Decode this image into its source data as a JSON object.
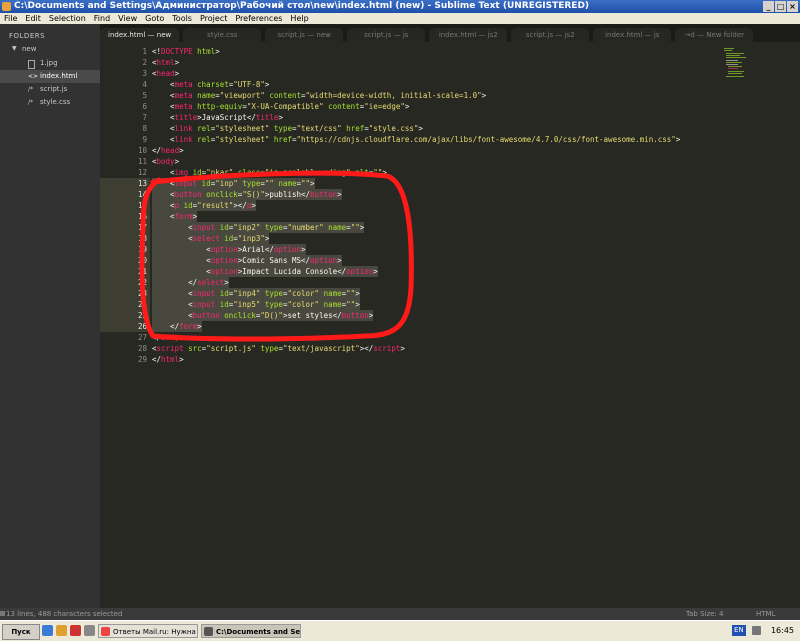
{
  "window": {
    "title": "C:\\Documents and Settings\\Администратор\\Рабочий стол\\new\\index.html (new) - Sublime Text (UNREGISTERED)",
    "controls": [
      "_",
      "□",
      "×"
    ]
  },
  "menu": [
    "File",
    "Edit",
    "Selection",
    "Find",
    "View",
    "Goto",
    "Tools",
    "Project",
    "Preferences",
    "Help"
  ],
  "sidebar": {
    "header": "FOLDERS",
    "folder": "new",
    "files": [
      {
        "name": "1.jpg",
        "active": false
      },
      {
        "name": "index.html",
        "active": true
      },
      {
        "name": "script.js",
        "active": false
      },
      {
        "name": "style.css",
        "active": false
      }
    ]
  },
  "tabs": [
    {
      "label": "index.html — new",
      "active": true
    },
    {
      "label": "style.css",
      "active": false
    },
    {
      "label": "script.js — new",
      "active": false
    },
    {
      "label": "script.js — js",
      "active": false
    },
    {
      "label": "index.html — js2",
      "active": false
    },
    {
      "label": "script.js — js2",
      "active": false
    },
    {
      "label": "index.html — js",
      "active": false
    },
    {
      "label": "→d — New folder",
      "active": false
    }
  ],
  "code_lines": [
    {
      "n": "1",
      "html": "<span class=\"p\">&lt;!</span><span class=\"t\">DOCTYPE</span> <span class=\"a\">html</span><span class=\"p\">&gt;</span>"
    },
    {
      "n": "2",
      "html": "&lt;<span class=\"t\">html</span>&gt;"
    },
    {
      "n": "3",
      "html": "&lt;<span class=\"t\">head</span>&gt;"
    },
    {
      "n": "4",
      "html": "    &lt;<span class=\"t\">meta</span> <span class=\"a\">charset</span>=<span class=\"s\">\"UTF-8\"</span>&gt;"
    },
    {
      "n": "5",
      "html": "    &lt;<span class=\"t\">meta</span> <span class=\"a\">name</span>=<span class=\"s\">\"viewport\"</span> <span class=\"a\">content</span>=<span class=\"s\">\"width=device-width, initial-scale=1.0\"</span>&gt;"
    },
    {
      "n": "6",
      "html": "    &lt;<span class=\"t\">meta</span> <span class=\"a\">http-equiv</span>=<span class=\"s\">\"X-UA-Compatible\"</span> <span class=\"a\">content</span>=<span class=\"s\">\"ie=edge\"</span>&gt;"
    },
    {
      "n": "7",
      "html": "    &lt;<span class=\"t\">title</span>&gt;JavaScript&lt;/<span class=\"t\">title</span>&gt;"
    },
    {
      "n": "8",
      "html": "    &lt;<span class=\"t\">link</span> <span class=\"a\">rel</span>=<span class=\"s\">\"stylesheet\"</span> <span class=\"a\">type</span>=<span class=\"s\">\"text/css\"</span> <span class=\"a\">href</span>=<span class=\"s\">\"style.css\"</span>&gt;"
    },
    {
      "n": "9",
      "html": "    &lt;<span class=\"t\">link</span> <span class=\"a\">rel</span>=<span class=\"s\">\"stylesheet\"</span> <span class=\"a\">href</span>=<span class=\"s\">\"https://cdnjs.cloudflare.com/ajax/libs/font-awesome/4.7.0/css/font-awesome.min.css\"</span>&gt;"
    },
    {
      "n": "10",
      "html": "&lt;/<span class=\"t\">head</span>&gt;"
    },
    {
      "n": "11",
      "html": "&lt;<span class=\"t\">body</span>&gt;"
    },
    {
      "n": "12",
      "html": "    &lt;<span class=\"t\">img</span> <span class=\"a\">id</span>=<span class=\"s\">\"nkar\"</span> <span class=\"a\">class</span>=<span class=\"s\">\"is-scalabl  ading\"</span> <span class=\"a\">alt</span>=<span class=\"s\">\"\"</span>&gt;"
    },
    {
      "n": "13",
      "sel": true,
      "html": "    &lt;<span class=\"t\">input</span> <span class=\"a\">id</span>=<span class=\"s\">\"inp\"</span> <span class=\"a\">type</span>=<span class=\"s\">\"\"</span> <span class=\"a\">name</span>=<span class=\"s\">\"\"</span>&gt;"
    },
    {
      "n": "14",
      "sel": true,
      "html": "    &lt;<span class=\"t\">button</span> <span class=\"a\">onclick</span>=<span class=\"s\">\"S()\"</span>&gt;publish&lt;/<span class=\"t\">button</span>&gt;"
    },
    {
      "n": "15",
      "sel": true,
      "html": "    &lt;<span class=\"t\">p</span> <span class=\"a\">id</span>=<span class=\"s\">\"result\"</span>&gt;&lt;/<span class=\"t\">p</span>&gt;"
    },
    {
      "n": "16",
      "sel": true,
      "html": "    &lt;<span class=\"t\">form</span>&gt;"
    },
    {
      "n": "17",
      "sel": true,
      "html": "        &lt;<span class=\"t\">input</span> <span class=\"a\">id</span>=<span class=\"s\">\"inp2\"</span> <span class=\"a\">type</span>=<span class=\"s\">\"number\"</span> <span class=\"a\">name</span>=<span class=\"s\">\"\"</span>&gt;"
    },
    {
      "n": "18",
      "sel": true,
      "html": "        &lt;<span class=\"t\">select</span> <span class=\"a\">id</span>=<span class=\"s\">\"inp3\"</span>&gt;"
    },
    {
      "n": "19",
      "sel": true,
      "html": "            &lt;<span class=\"t\">option</span>&gt;Arial&lt;/<span class=\"t\">option</span>&gt;"
    },
    {
      "n": "20",
      "sel": true,
      "html": "            &lt;<span class=\"t\">option</span>&gt;Comic Sans MS&lt;/<span class=\"t\">option</span>&gt;"
    },
    {
      "n": "21",
      "sel": true,
      "html": "            &lt;<span class=\"t\">option</span>&gt;Impact Lucida Console&lt;/<span class=\"t\">option</span>&gt;"
    },
    {
      "n": "22",
      "sel": true,
      "html": "        &lt;/<span class=\"t\">select</span>&gt;"
    },
    {
      "n": "23",
      "sel": true,
      "html": "        &lt;<span class=\"t\">input</span> <span class=\"a\">id</span>=<span class=\"s\">\"inp4\"</span> <span class=\"a\">type</span>=<span class=\"s\">\"color\"</span> <span class=\"a\">name</span>=<span class=\"s\">\"\"</span>&gt;"
    },
    {
      "n": "24",
      "sel": true,
      "html": "        &lt;<span class=\"t\">input</span> <span class=\"a\">id</span>=<span class=\"s\">\"inp5\"</span> <span class=\"a\">type</span>=<span class=\"s\">\"color\"</span> <span class=\"a\">name</span>=<span class=\"s\">\"\"</span>&gt;"
    },
    {
      "n": "25",
      "sel": true,
      "html": "        &lt;<span class=\"t\">button</span> <span class=\"a\">onclick</span>=<span class=\"s\">\"D()\"</span>&gt;set styles&lt;/<span class=\"t\">button</span>&gt;"
    },
    {
      "n": "26",
      "sel": true,
      "html": "    &lt;/<span class=\"t\">form</span>&gt;"
    },
    {
      "n": "27",
      "html": "&lt;/<span class=\"t\">body</span>&gt;"
    },
    {
      "n": "28",
      "html": "&lt;<span class=\"t\">script</span> <span class=\"a\">src</span>=<span class=\"s\">\"script.js\"</span> <span class=\"a\">type</span>=<span class=\"s\">\"text/javascript\"</span>&gt;&lt;/<span class=\"t\">script</span>&gt;"
    },
    {
      "n": "29",
      "html": "&lt;/<span class=\"t\">html</span>&gt;"
    }
  ],
  "status": {
    "left": "13 lines, 488 characters selected",
    "tab_size": "Tab Size: 4",
    "syntax": "HTML"
  },
  "taskbar": {
    "start": "Пуск",
    "tasks": [
      {
        "label": "Ответы Mail.ru: Нужна ...",
        "active": false,
        "icon_color": "#e44"
      },
      {
        "label": "C:\\Documents and Se...",
        "active": true,
        "icon_color": "#555"
      }
    ],
    "lang": "EN",
    "clock": "16:45"
  },
  "colors": {
    "editor_bg": "#272822",
    "annotation": "#ff0000",
    "tag": "#f92672",
    "attr": "#a6e22e",
    "string": "#e6db74"
  }
}
